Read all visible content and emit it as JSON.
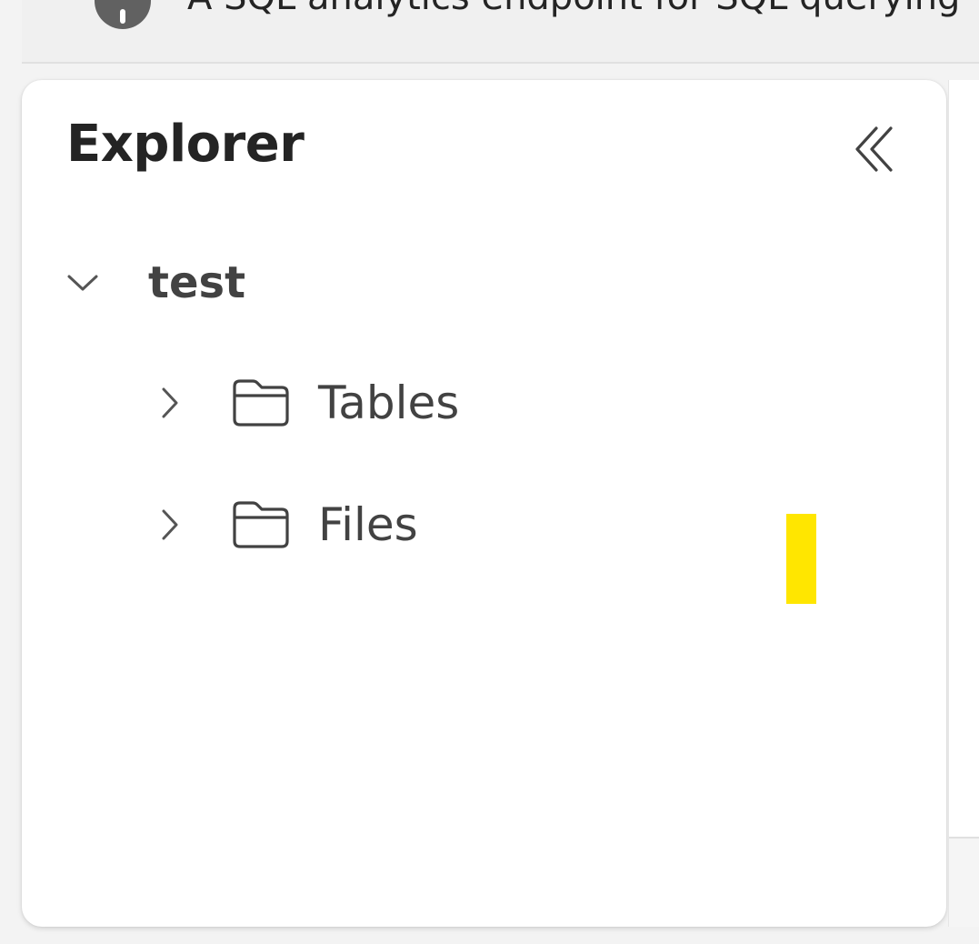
{
  "banner": {
    "icon": "info-icon",
    "text": "A SQL analytics endpoint for SQL querying"
  },
  "explorer": {
    "title": "Explorer",
    "collapse_icon": "double-chevron-left-icon",
    "tree": {
      "root": {
        "label": "test",
        "expanded": true,
        "icon": "chevron-down-icon"
      },
      "children": [
        {
          "label": "Tables",
          "expanded": false,
          "icon": "folder-icon"
        },
        {
          "label": "Files",
          "expanded": false,
          "icon": "folder-icon"
        }
      ]
    }
  },
  "colors": {
    "highlight_marker": "#ffe600",
    "panel_background": "#ffffff",
    "page_background": "#f3f3f3"
  }
}
